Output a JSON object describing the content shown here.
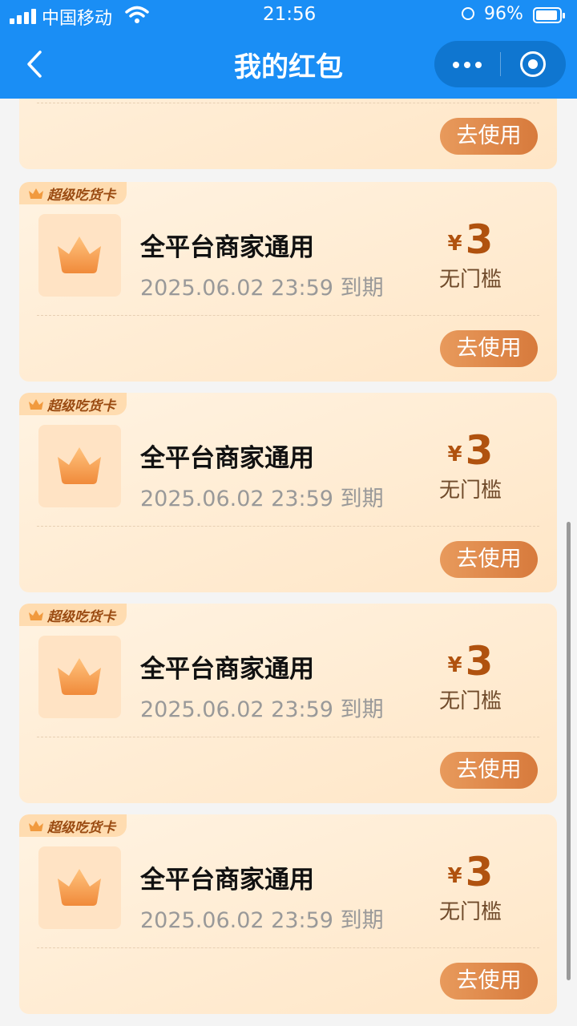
{
  "status_bar": {
    "carrier": "中国移动",
    "time": "21:56",
    "battery": "96%"
  },
  "header": {
    "title": "我的红包"
  },
  "colors": {
    "header_blue": "#1a8ef5",
    "card_bg": "#ffe9cf",
    "accent_brown": "#b0520f",
    "button_orange": "#e08a4c"
  },
  "top_card": {
    "button": "去使用"
  },
  "cards": [
    {
      "badge": "超级吃货卡",
      "title": "全平台商家通用",
      "expiry": "2025.06.02 23:59 到期",
      "currency": "¥",
      "amount": "3",
      "threshold": "无门槛",
      "button": "去使用"
    },
    {
      "badge": "超级吃货卡",
      "title": "全平台商家通用",
      "expiry": "2025.06.02 23:59 到期",
      "currency": "¥",
      "amount": "3",
      "threshold": "无门槛",
      "button": "去使用"
    },
    {
      "badge": "超级吃货卡",
      "title": "全平台商家通用",
      "expiry": "2025.06.02 23:59 到期",
      "currency": "¥",
      "amount": "3",
      "threshold": "无门槛",
      "button": "去使用"
    },
    {
      "badge": "超级吃货卡",
      "title": "全平台商家通用",
      "expiry": "2025.06.02 23:59 到期",
      "currency": "¥",
      "amount": "3",
      "threshold": "无门槛",
      "button": "去使用"
    }
  ]
}
